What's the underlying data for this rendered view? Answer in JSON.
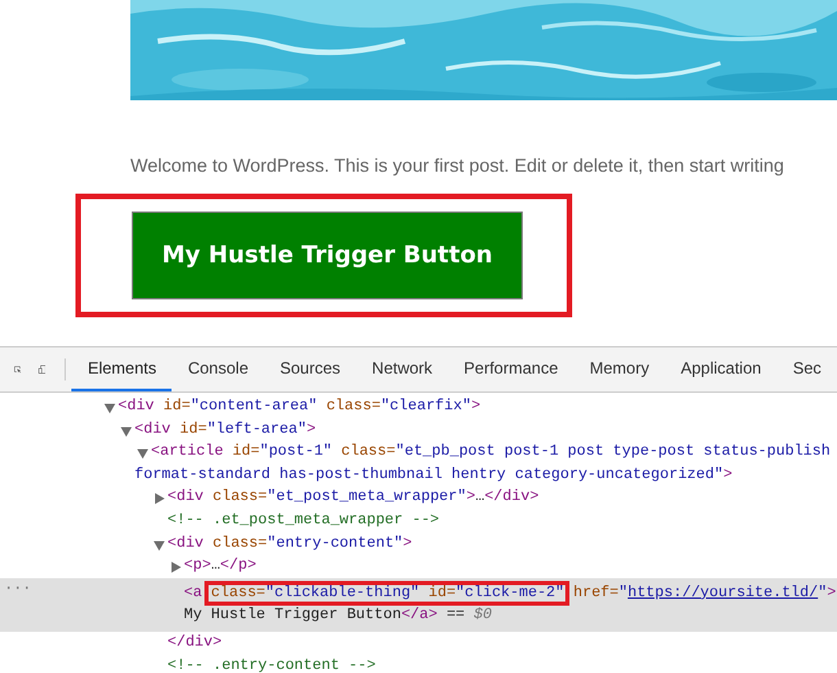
{
  "page": {
    "paragraph": "Welcome to WordPress. This is your first post. Edit or delete it, then start writing",
    "button": {
      "label": "My Hustle Trigger Button",
      "highlighted": true
    }
  },
  "devtools": {
    "tabs": [
      {
        "label": "Elements",
        "selected": true
      },
      {
        "label": "Console",
        "selected": false
      },
      {
        "label": "Sources",
        "selected": false
      },
      {
        "label": "Network",
        "selected": false
      },
      {
        "label": "Performance",
        "selected": false
      },
      {
        "label": "Memory",
        "selected": false
      },
      {
        "label": "Application",
        "selected": false
      },
      {
        "label": "Sec",
        "selected": false
      }
    ],
    "dom_tree": [
      {
        "selected": false,
        "expanded": true,
        "lines": [
          [
            {
              "kind": "tag",
              "text": "<div"
            },
            {
              "kind": "attr",
              "text": " id="
            },
            {
              "kind": "value",
              "text": "\"content-area\""
            },
            {
              "kind": "attr",
              "text": " class="
            },
            {
              "kind": "value",
              "text": "\"clearfix\""
            },
            {
              "kind": "tag",
              "text": ">"
            }
          ]
        ],
        "children": [
          {
            "selected": false,
            "expanded": true,
            "lines": [
              [
                {
                  "kind": "tag",
                  "text": "<div"
                },
                {
                  "kind": "attr",
                  "text": " id="
                },
                {
                  "kind": "value",
                  "text": "\"left-area\""
                },
                {
                  "kind": "tag",
                  "text": ">"
                }
              ]
            ],
            "children": [
              {
                "selected": false,
                "expanded": true,
                "lines": [
                  [
                    {
                      "kind": "tag",
                      "text": "<article"
                    },
                    {
                      "kind": "attr",
                      "text": " id="
                    },
                    {
                      "kind": "value",
                      "text": "\"post-1\""
                    },
                    {
                      "kind": "attr",
                      "text": " class="
                    },
                    {
                      "kind": "value",
                      "text": "\"et_pb_post post-1 post type-post status-publish"
                    }
                  ],
                  [
                    {
                      "kind": "value",
                      "text": "format-standard has-post-thumbnail hentry category-uncategorized\""
                    },
                    {
                      "kind": "tag",
                      "text": ">"
                    }
                  ]
                ],
                "children": [
                  {
                    "selected": false,
                    "expanded": false,
                    "lines": [
                      [
                        {
                          "kind": "tag",
                          "text": "<div"
                        },
                        {
                          "kind": "attr",
                          "text": " class="
                        },
                        {
                          "kind": "value",
                          "text": "\"et_post_meta_wrapper\""
                        },
                        {
                          "kind": "tag",
                          "text": ">"
                        },
                        {
                          "kind": "text",
                          "text": "…"
                        },
                        {
                          "kind": "tag",
                          "text": "</div>"
                        }
                      ]
                    ]
                  },
                  {
                    "selected": false,
                    "lines": [
                      [
                        {
                          "kind": "comment",
                          "text": "<!-- .et_post_meta_wrapper -->"
                        }
                      ]
                    ]
                  },
                  {
                    "selected": false,
                    "expanded": true,
                    "lines": [
                      [
                        {
                          "kind": "tag",
                          "text": "<div"
                        },
                        {
                          "kind": "attr",
                          "text": " class="
                        },
                        {
                          "kind": "value",
                          "text": "\"entry-content\""
                        },
                        {
                          "kind": "tag",
                          "text": ">"
                        }
                      ]
                    ],
                    "children": [
                      {
                        "selected": false,
                        "expanded": false,
                        "lines": [
                          [
                            {
                              "kind": "tag",
                              "text": "<p>"
                            },
                            {
                              "kind": "text",
                              "text": "…"
                            },
                            {
                              "kind": "tag",
                              "text": "</p>"
                            }
                          ]
                        ]
                      },
                      {
                        "selected": true,
                        "gutter": "···",
                        "lines": [
                          [
                            {
                              "kind": "tag",
                              "text": "<a"
                            },
                            {
                              "kind": "attr",
                              "text": " class=",
                              "boxed": true
                            },
                            {
                              "kind": "value",
                              "text": "\"clickable-thing\"",
                              "boxed": true
                            },
                            {
                              "kind": "attr",
                              "text": " id=",
                              "boxed": true
                            },
                            {
                              "kind": "value",
                              "text": "\"click-me-2\"",
                              "boxed": true
                            },
                            {
                              "kind": "attr",
                              "text": " href="
                            },
                            {
                              "kind": "value",
                              "text": "\""
                            },
                            {
                              "kind": "link",
                              "text": "https://yoursite.tld/"
                            },
                            {
                              "kind": "value",
                              "text": "\""
                            },
                            {
                              "kind": "tag",
                              "text": ">"
                            }
                          ],
                          [
                            {
                              "kind": "text",
                              "text": "My Hustle Trigger Button"
                            },
                            {
                              "kind": "tag",
                              "text": "</a>"
                            },
                            {
                              "kind": "text",
                              "text": " == "
                            },
                            {
                              "kind": "note",
                              "text": "$0"
                            }
                          ]
                        ]
                      }
                    ]
                  },
                  {
                    "selected": false,
                    "lines": [
                      [
                        {
                          "kind": "tag",
                          "text": "</div>"
                        }
                      ]
                    ]
                  },
                  {
                    "selected": false,
                    "lines": [
                      [
                        {
                          "kind": "comment",
                          "text": "<!-- .entry-content -->"
                        }
                      ]
                    ]
                  }
                ]
              }
            ]
          }
        ]
      }
    ]
  }
}
